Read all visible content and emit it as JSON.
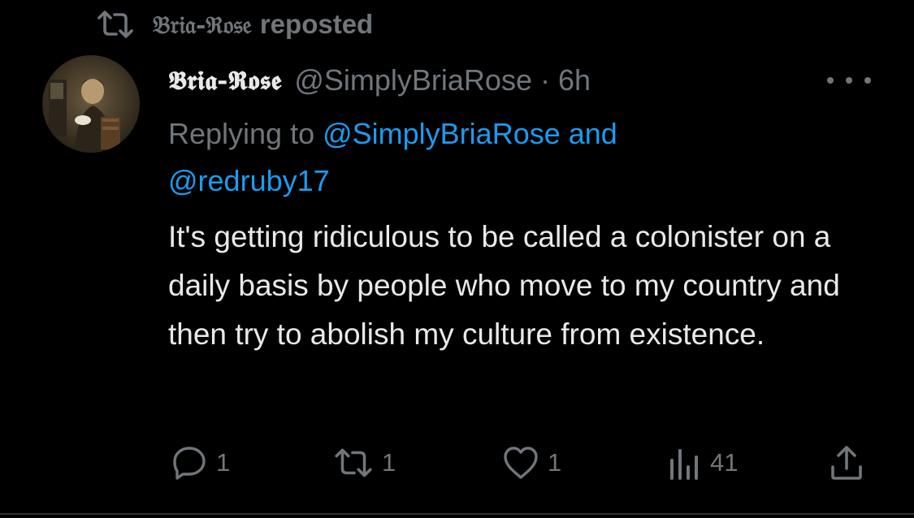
{
  "repost_banner": {
    "icon": "repost-icon",
    "name": "𝔅𝔯𝔦𝔞-ℜ𝔬𝔰𝔢",
    "verb": "reposted"
  },
  "tweet": {
    "avatar": "avatar",
    "display_name": "𝕭𝖗𝖎𝖆-𝕽𝖔𝖘𝖊",
    "handle": "@SimplyBriaRose",
    "separator": "·",
    "time": "6h",
    "more_icon": "more-horizontal-icon",
    "replying_prefix": "Replying to ",
    "replying_handle_1": "@SimplyBriaRose",
    "replying_joiner": " and",
    "replying_handle_2": "@redruby17",
    "text": "It's getting ridiculous to be called a colonister on a daily basis by people who move to my country and then try to abolish my culture from existence."
  },
  "actions": {
    "reply": {
      "icon": "reply-icon",
      "count": "1"
    },
    "repost": {
      "icon": "repost-icon",
      "count": "1"
    },
    "like": {
      "icon": "heart-icon",
      "count": "1"
    },
    "views": {
      "icon": "views-icon",
      "count": "41"
    },
    "share": {
      "icon": "share-icon"
    }
  },
  "colors": {
    "background": "#000000",
    "text_primary": "#e7e9ea",
    "text_secondary": "#71767b",
    "link": "#1d9bf0"
  }
}
